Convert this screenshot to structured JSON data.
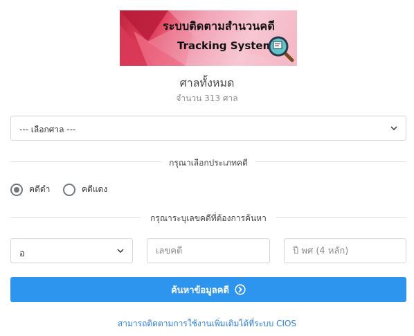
{
  "banner": {
    "title_th": "ระบบติดตามสำนวนคดี",
    "title_en": "Tracking System"
  },
  "court": {
    "title": "ศาลทั้งหมด",
    "count": "จำนวน 313 ศาล",
    "select_value": "--- เลือกศาล ---"
  },
  "case_type": {
    "divider": "กรุณาเลือกประเภทคดี",
    "options": [
      {
        "label": "คดีดำ",
        "checked": true
      },
      {
        "label": "คดีแดง",
        "checked": false
      }
    ]
  },
  "case_number": {
    "divider": "กรุณาระบุเลขคดีที่ต้องการค้นหา",
    "prefix_value": "อ",
    "number_placeholder": "เลขคดี",
    "year_placeholder": "ปี พศ (4 หลัก)"
  },
  "search_button": {
    "label": "ค้นหาข้อมูลคดี"
  },
  "footer_link": {
    "label": "สามารถติดตามการใช้งานเพิ่มเติมได้ที่ระบบ CIOS"
  },
  "colors": {
    "primary": "#2d95ee",
    "link": "#2d7fd6",
    "banner_accent": "#d8304f"
  },
  "icons": {
    "court_select": "chevron-down-icon",
    "prefix_select": "chevron-down-icon",
    "search_button": "arrow-circle-right-icon",
    "banner": "magnifier-document-icon"
  }
}
